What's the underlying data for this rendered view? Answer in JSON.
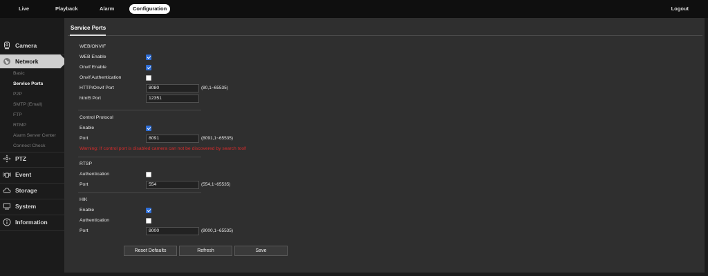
{
  "nav": {
    "items": [
      {
        "label": "Live"
      },
      {
        "label": "Playback"
      },
      {
        "label": "Alarm"
      },
      {
        "label": "Configuration"
      }
    ],
    "logout": "Logout"
  },
  "sidebar": {
    "items": [
      {
        "label": "Camera",
        "icon": "camera-icon"
      },
      {
        "label": "Network",
        "icon": "globe-icon"
      },
      {
        "label": "PTZ",
        "icon": "ptz-icon"
      },
      {
        "label": "Event",
        "icon": "event-icon"
      },
      {
        "label": "Storage",
        "icon": "cloud-icon"
      },
      {
        "label": "System",
        "icon": "monitor-icon"
      },
      {
        "label": "Information",
        "icon": "info-icon"
      }
    ],
    "network_sub": [
      "Basic",
      "Service Ports",
      "P2P",
      "SMTP (Email)",
      "FTP",
      "RTMP",
      "Alarm Server Center",
      "Connect Check"
    ]
  },
  "page": {
    "title": "Service Ports",
    "web": {
      "section": "WEB/ONVIF",
      "web_enable": "WEB Enable",
      "onvif_enable": "Onvif Enable",
      "onvif_auth": "Onvif Authentication",
      "http_port_label": "HTTP/Onvif Port",
      "http_port_value": "8080",
      "http_port_range": "(80,1~65535)",
      "html5_port_label": "html5 Port",
      "html5_port_value": "12351",
      "web_enable_checked": true,
      "onvif_enable_checked": true,
      "onvif_auth_checked": false
    },
    "control": {
      "section": "Control Protocol",
      "enable": "Enable",
      "enable_checked": true,
      "port_label": "Port",
      "port_value": "8091",
      "port_range": "(8091,1~65535)",
      "warning": "Warning: If control port is disabled camera can not be discovered by search tool!"
    },
    "rtsp": {
      "section": "RTSP",
      "auth": "Authentication",
      "auth_checked": false,
      "port_label": "Port",
      "port_value": "554",
      "port_range": "(554,1~65535)"
    },
    "hik": {
      "section": "HIK",
      "enable": "Enable",
      "enable_checked": true,
      "auth": "Authentication",
      "auth_checked": false,
      "port_label": "Port",
      "port_value": "8000",
      "port_range": "(8000,1~65535)"
    },
    "buttons": {
      "reset": "Reset Defaults",
      "refresh": "Refresh",
      "save": "Save"
    }
  },
  "colors": {
    "warning": "#d92b2b",
    "checkbox_on": "#2f6fd8"
  }
}
